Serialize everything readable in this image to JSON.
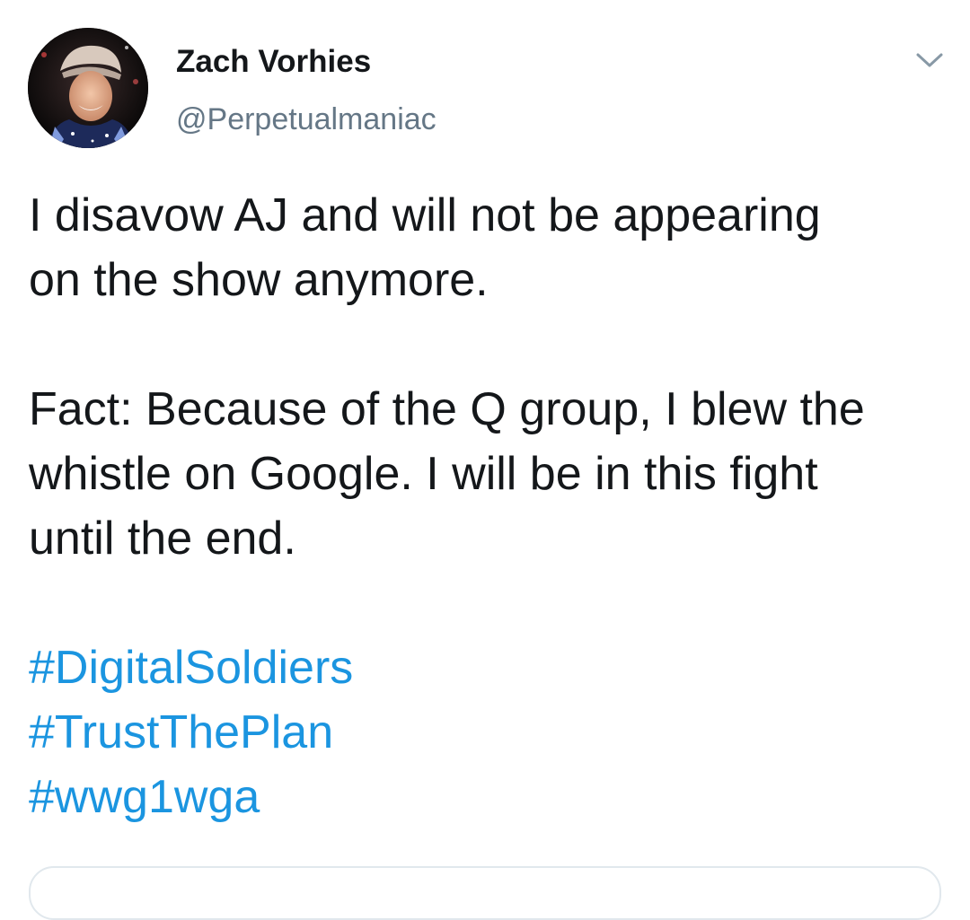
{
  "tweet": {
    "author": {
      "display_name": "Zach Vorhies",
      "handle": "@Perpetualmaniac",
      "avatar_icon": "profile-photo"
    },
    "menu_icon": "chevron-down-icon",
    "body": {
      "line1": "I disavow AJ and will not be appearing",
      "line2": "on the show anymore.",
      "line3": "Fact: Because of the Q group, I blew the",
      "line4": "whistle on Google. I will be in this fight",
      "line5": "until the end."
    },
    "hashtags": [
      "#DigitalSoldiers",
      "#TrustThePlan",
      "#wwg1wga"
    ]
  },
  "colors": {
    "text": "#14171a",
    "secondary": "#657786",
    "link": "#1b95e0",
    "border": "#e1e8ed"
  }
}
